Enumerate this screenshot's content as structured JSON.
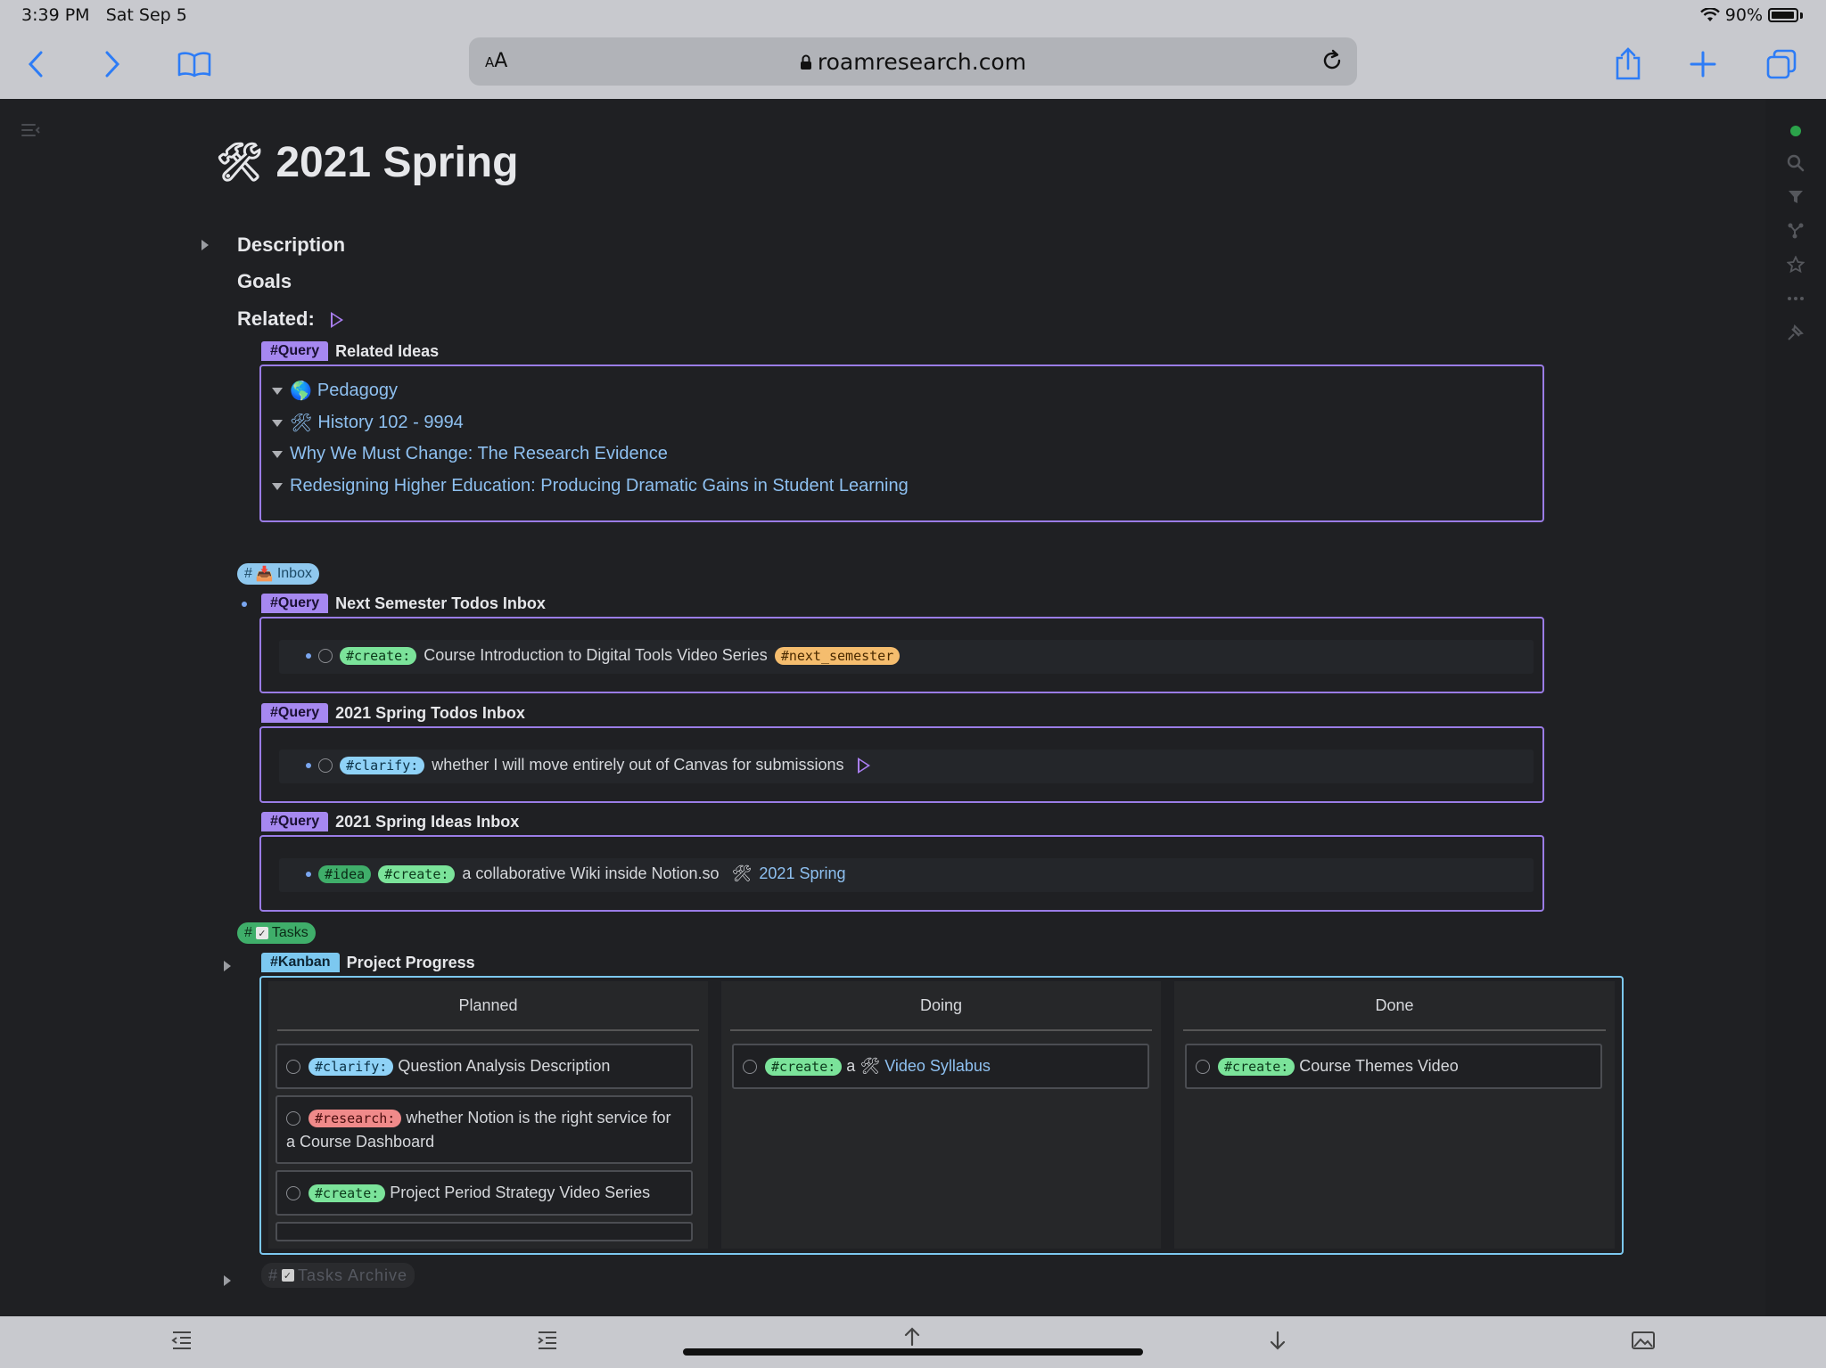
{
  "status": {
    "time": "3:39 PM",
    "date": "Sat Sep 5",
    "battery": "90%"
  },
  "browser": {
    "aa_label": "AA",
    "url": "roamresearch.com"
  },
  "page": {
    "title": "2021 Spring",
    "title_emoji": "🛠"
  },
  "sections": {
    "description": "Description",
    "goals": "Goals",
    "related": "Related:"
  },
  "related_query": {
    "tag": "#Query",
    "title": "Related Ideas",
    "items": [
      {
        "emoji": "🌎",
        "label": "Pedagogy"
      },
      {
        "emoji": "🛠",
        "label": "History 102 - 9994"
      },
      {
        "emoji": "",
        "label": "Why We Must Change: The Research Evidence"
      },
      {
        "emoji": "",
        "label": "Redesigning Higher Education: Producing Dramatic Gains in Student Learning"
      }
    ]
  },
  "inbox_tag": {
    "hash": "#",
    "emoji": "📥",
    "label": "Inbox"
  },
  "inbox_queries": [
    {
      "tag": "#Query",
      "title": "Next Semester Todos Inbox",
      "item": {
        "pill1": "#create:",
        "text": "Course Introduction to Digital Tools Video Series",
        "pill2": "#next_semester"
      }
    },
    {
      "tag": "#Query",
      "title": "2021 Spring Todos Inbox",
      "item": {
        "pill1": "#clarify:",
        "text": "whether I will move entirely out of Canvas for submissions"
      }
    },
    {
      "tag": "#Query",
      "title": "2021 Spring Ideas Inbox",
      "item": {
        "pill0": "#idea",
        "pill1": "#create:",
        "text": "a collaborative Wiki inside Notion.so",
        "link_emoji": "🛠",
        "link": "2021 Spring"
      }
    }
  ],
  "tasks_tag": {
    "hash": "#",
    "label": "Tasks"
  },
  "kanban": {
    "tag": "#Kanban",
    "title": "Project Progress",
    "columns": [
      {
        "name": "Planned",
        "cards": [
          {
            "pill": "#clarify:",
            "pill_type": "clarify",
            "text": "Question Analysis Description"
          },
          {
            "pill": "#research:",
            "pill_type": "research",
            "text": "whether Notion is the right service for a Course Dashboard"
          },
          {
            "pill": "#create:",
            "pill_type": "create",
            "text": "Project Period Strategy Video Series"
          }
        ]
      },
      {
        "name": "Doing",
        "cards": [
          {
            "pill": "#create:",
            "pill_type": "create",
            "text": "a",
            "link_emoji": "🛠",
            "link": "Video Syllabus"
          }
        ]
      },
      {
        "name": "Done",
        "cards": [
          {
            "pill": "#create:",
            "pill_type": "create",
            "text": "Course Themes Video"
          }
        ]
      }
    ]
  },
  "archive_tag": {
    "hash": "#",
    "label": "Tasks Archive"
  },
  "colors": {
    "query_accent": "#a688f0",
    "kanban_accent": "#7cc8f0",
    "create": "#7be39a",
    "clarify": "#8fd2f7",
    "research": "#f08a8a",
    "next_semester": "#f5bd6e"
  }
}
